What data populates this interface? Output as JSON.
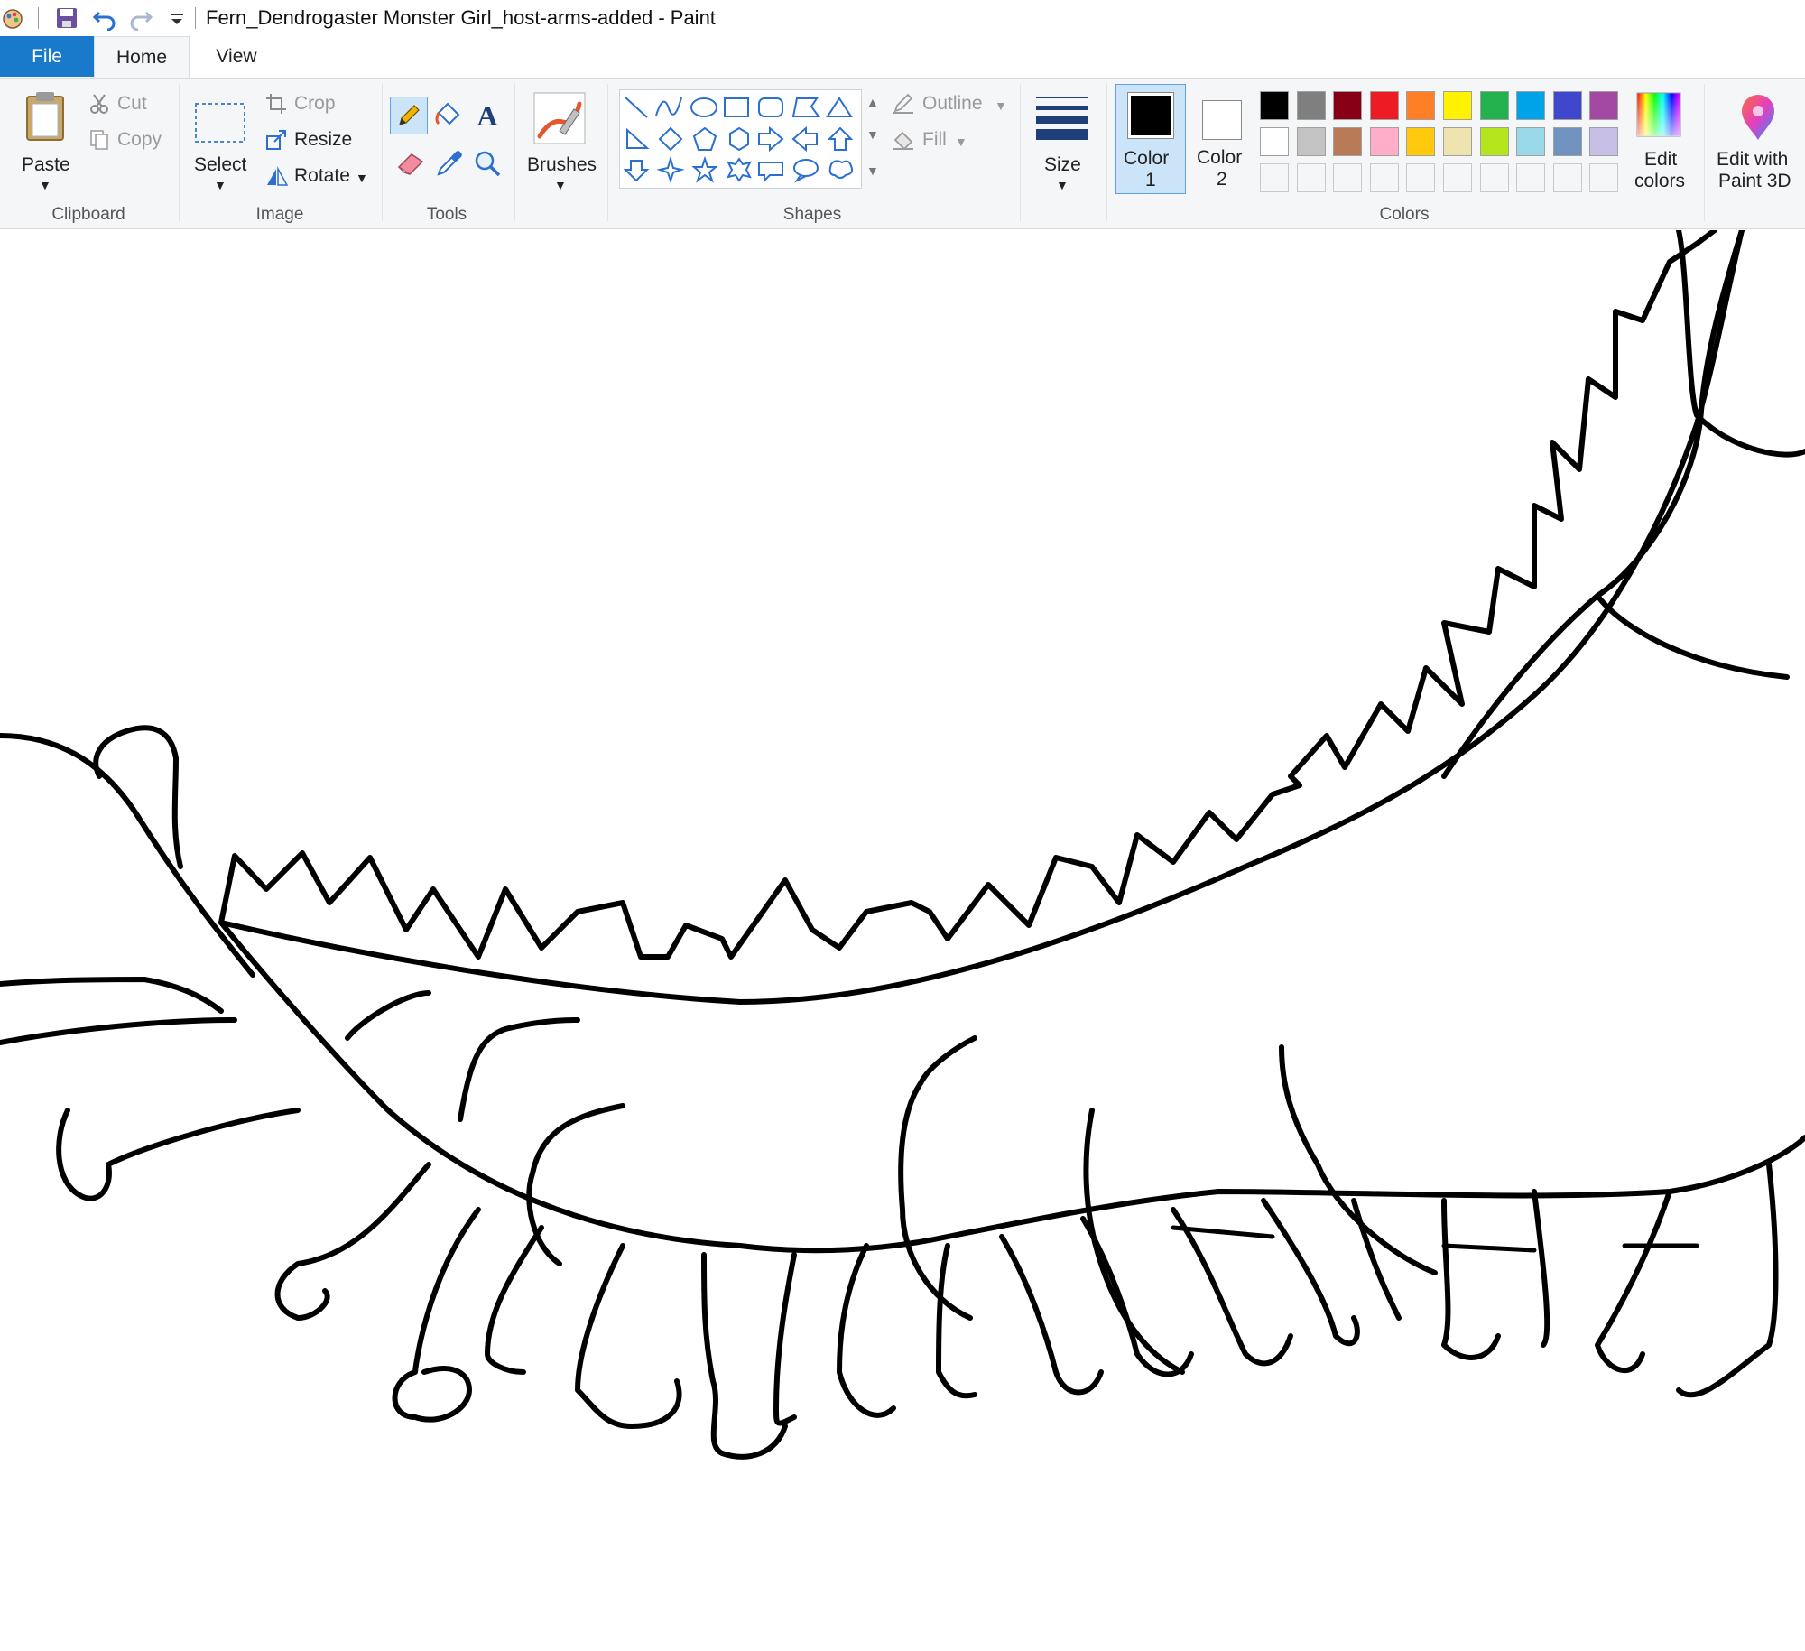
{
  "window": {
    "title": "Fern_Dendrogaster Monster Girl_host-arms-added - Paint"
  },
  "tabs": {
    "file": "File",
    "home": "Home",
    "view": "View"
  },
  "clipboard": {
    "paste": "Paste",
    "cut": "Cut",
    "copy": "Copy",
    "group_label": "Clipboard"
  },
  "image": {
    "select": "Select",
    "crop": "Crop",
    "resize": "Resize",
    "rotate": "Rotate",
    "group_label": "Image"
  },
  "tools": {
    "group_label": "Tools",
    "items": [
      "pencil-icon",
      "fill-bucket-icon",
      "text-icon",
      "eraser-icon",
      "color-picker-icon",
      "magnifier-icon"
    ],
    "active": "pencil"
  },
  "brushes": {
    "label": "Brushes"
  },
  "shapes": {
    "group_label": "Shapes",
    "outline": "Outline",
    "fill": "Fill"
  },
  "size": {
    "label": "Size"
  },
  "colors": {
    "group_label": "Colors",
    "color1_label": "Color 1",
    "color1_line1": "Color",
    "color1_line2": "1",
    "color2_line1": "Color",
    "color2_line2": "2",
    "color1": "#000000",
    "color2": "#ffffff",
    "palette_row1": [
      "#000000",
      "#7f7f7f",
      "#880015",
      "#ed1c24",
      "#ff7f27",
      "#fff200",
      "#22b14c",
      "#00a2e8",
      "#3f48cc",
      "#a349a4"
    ],
    "palette_row2": [
      "#ffffff",
      "#c3c3c3",
      "#b97a57",
      "#ffaec9",
      "#ffc90e",
      "#efe4b0",
      "#b5e61d",
      "#99d9ea",
      "#7092be",
      "#c8bfe7"
    ],
    "edit_colors_line1": "Edit",
    "edit_colors_line2": "colors",
    "paint3d_line1": "Edit with",
    "paint3d_line2": "Paint 3D"
  }
}
